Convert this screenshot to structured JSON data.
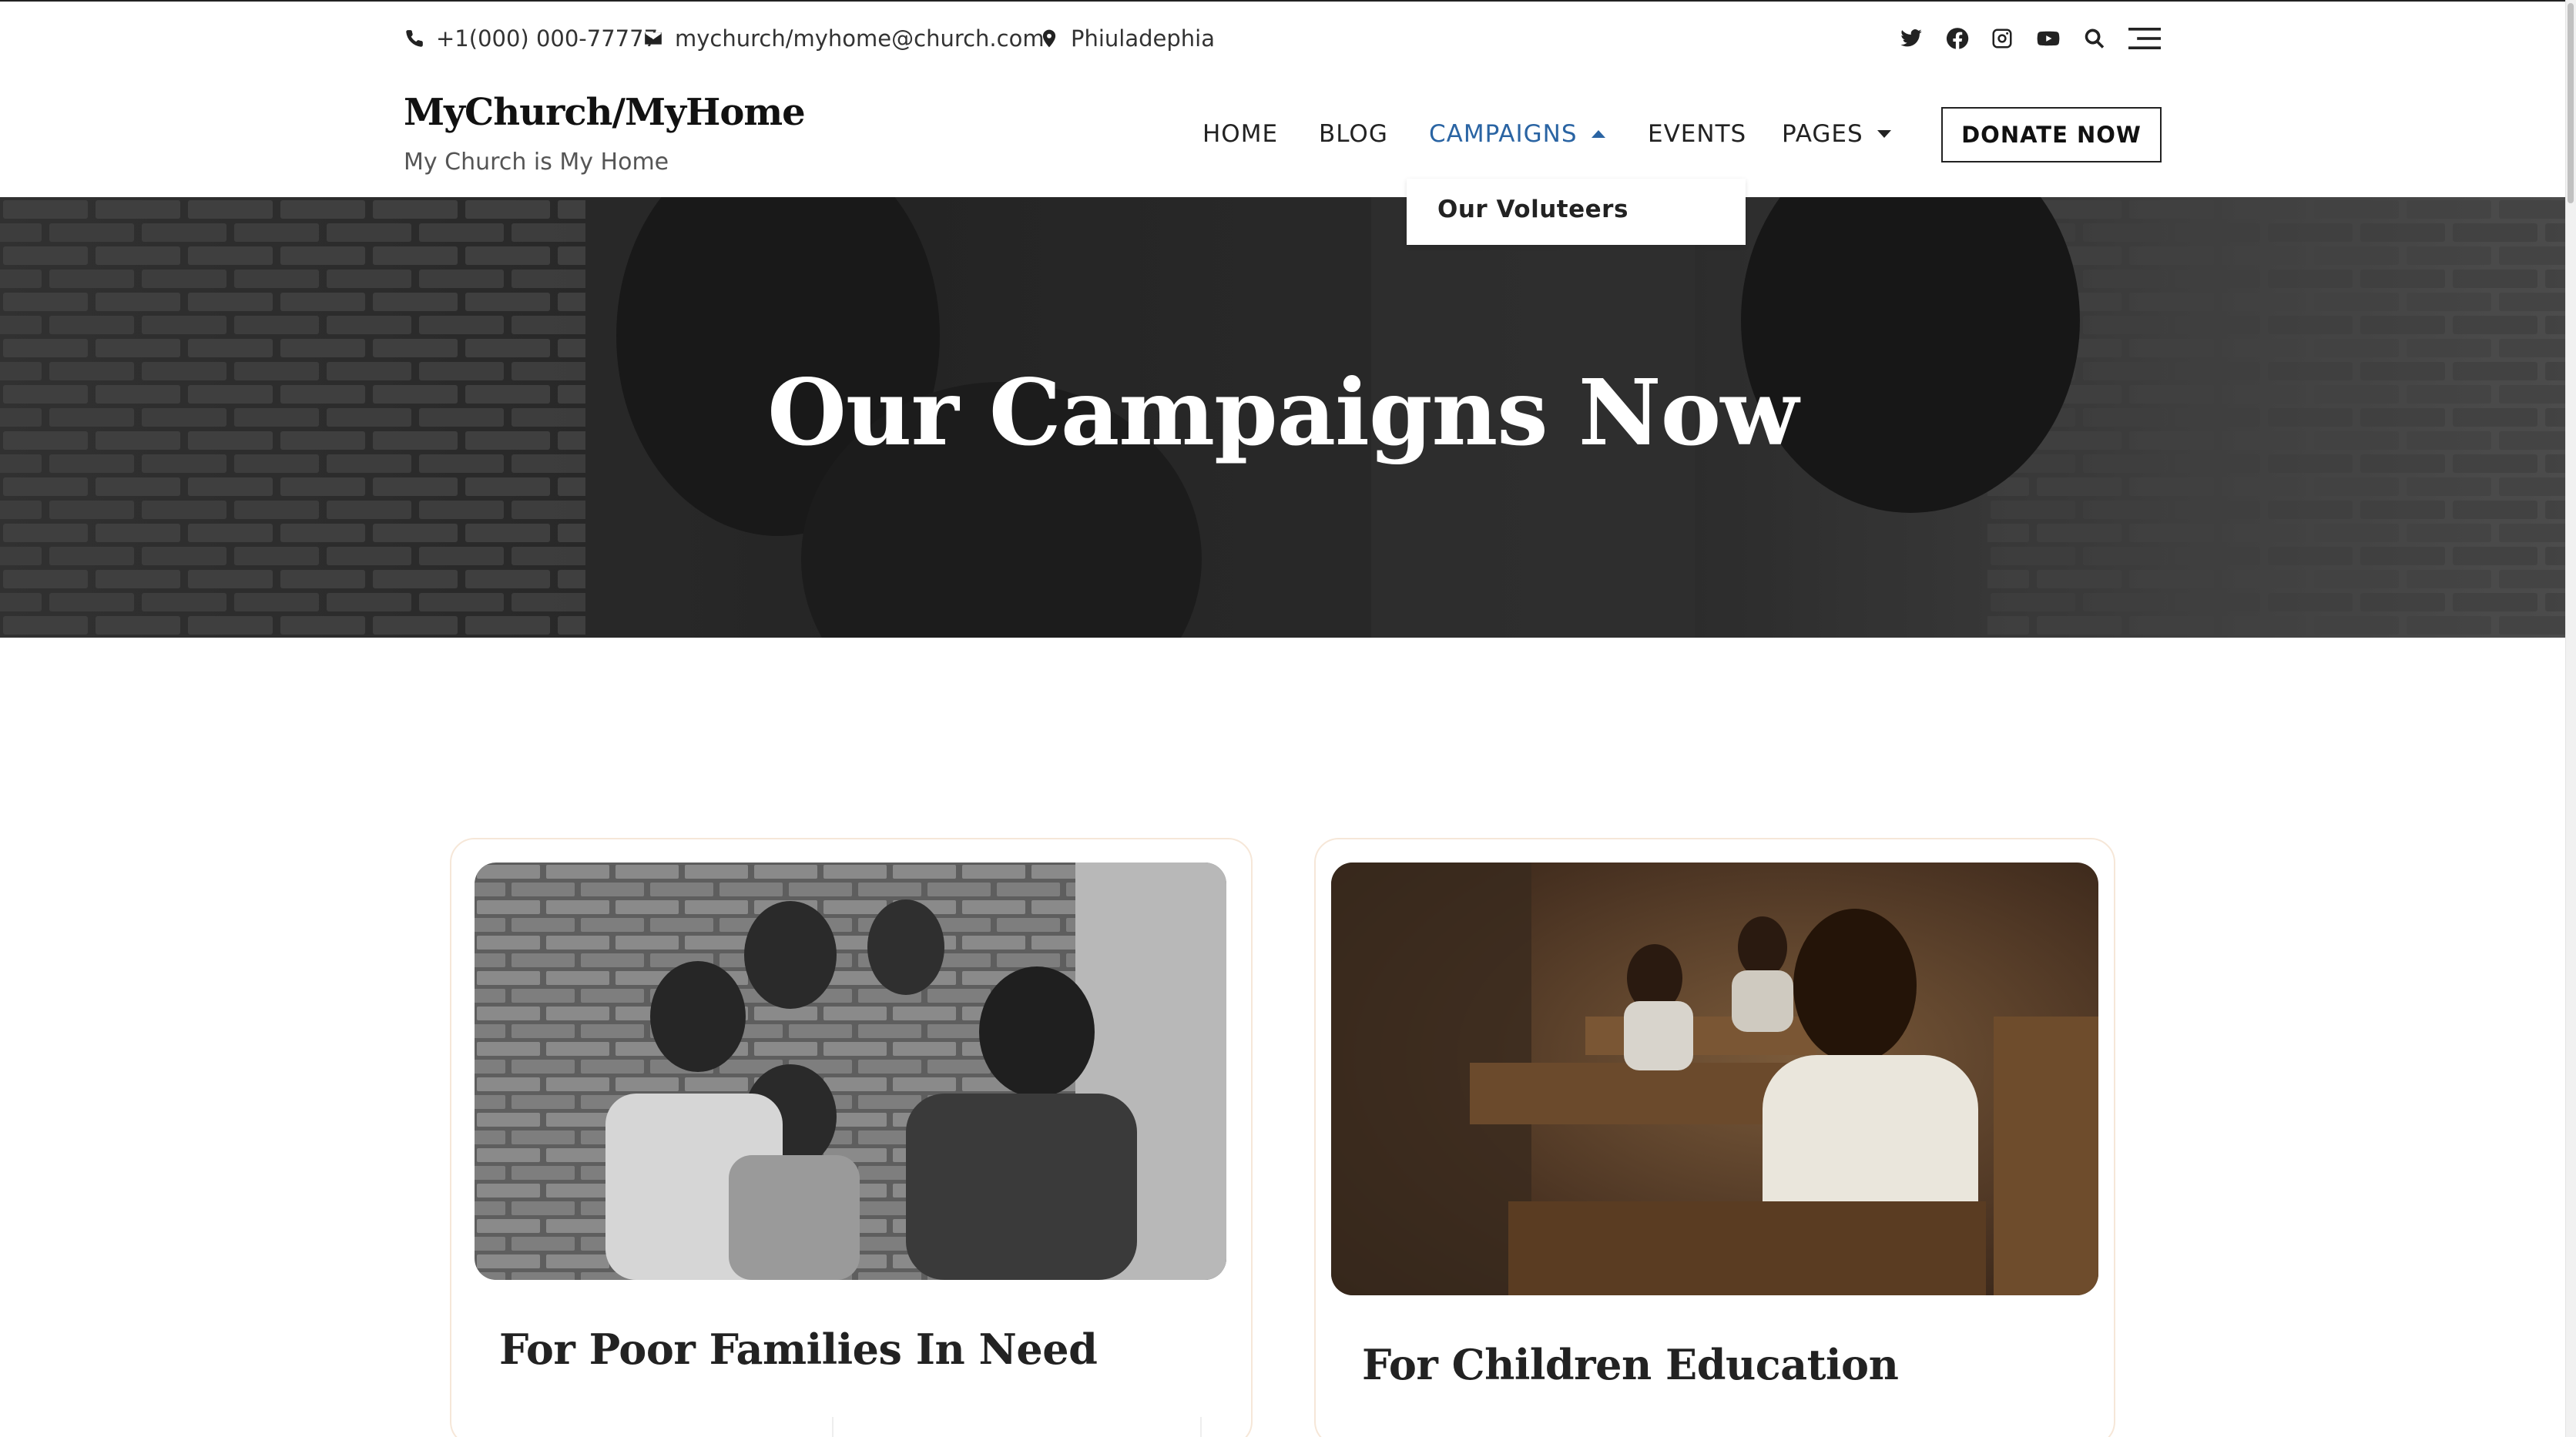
{
  "topbar": {
    "phone": "+1(000) 000-77777",
    "email": "mychurch/myhome@church.com",
    "location": "Phiuladephia",
    "social_icons": [
      "twitter-icon",
      "facebook-icon",
      "instagram-icon",
      "youtube-icon",
      "search-icon",
      "menu-icon"
    ]
  },
  "site": {
    "title": "MyChurch/MyHome",
    "tagline": "My Church is My Home"
  },
  "nav": {
    "items": [
      {
        "label": "HOME"
      },
      {
        "label": "BLOG"
      },
      {
        "label": "CAMPAIGNS",
        "active": true,
        "has_dropdown": true
      },
      {
        "label": "EVENTS"
      },
      {
        "label": "PAGES",
        "has_dropdown": true
      }
    ],
    "donate_label": "DONATE NOW",
    "active_color": "#2a64a3"
  },
  "dropdown": {
    "items": [
      "Our Voluteers"
    ]
  },
  "hero": {
    "title": "Our Campaigns Now"
  },
  "campaigns": [
    {
      "title": "For Poor Families In Need",
      "image": "children-group-photo"
    },
    {
      "title": "For Children Education",
      "image": "classroom-student-photo"
    }
  ]
}
